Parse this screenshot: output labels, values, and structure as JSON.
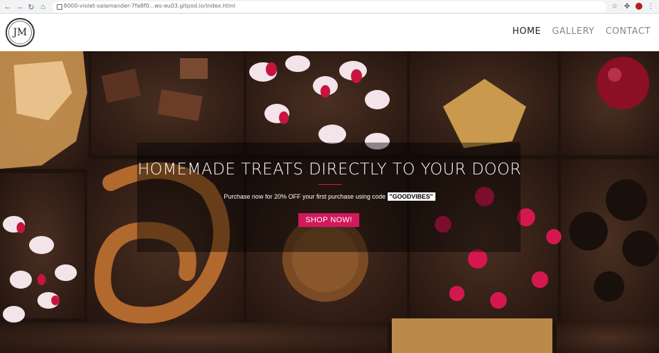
{
  "browser": {
    "url": "8000-violet-salamander-7fa8f0...ws-eu03.gitpod.io/index.html"
  },
  "site": {
    "logo_text": "JM",
    "nav": [
      {
        "label": "HOME"
      },
      {
        "label": "GALLERY"
      },
      {
        "label": "CONTACT"
      }
    ]
  },
  "hero": {
    "title": "HOMEMADE TREATS DIRECTLY TO YOUR DOOR",
    "subtitle": "Purchase now for 20% OFF your first purchase using code",
    "promo_code": "\"GOODVIBES\"",
    "cta": "SHOP NOW!"
  },
  "colors": {
    "accent": "#d1195b",
    "brownie": "#3b241a"
  }
}
